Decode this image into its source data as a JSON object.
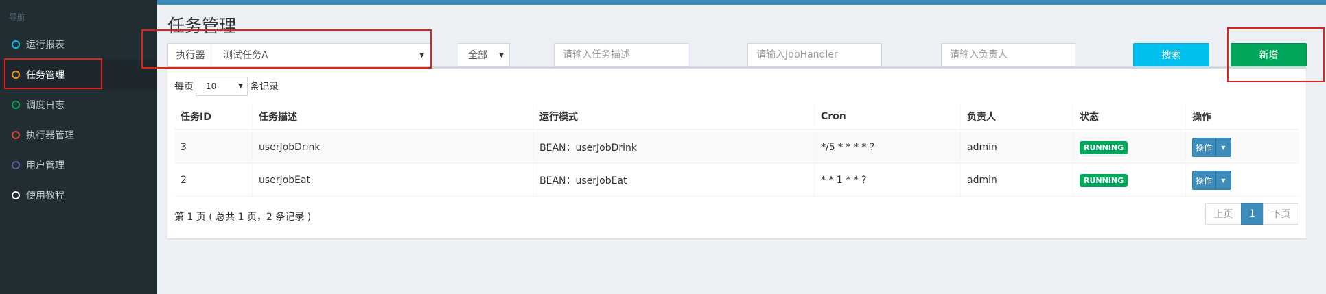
{
  "sidebar": {
    "header": "导航",
    "items": [
      {
        "label": "运行报表",
        "color": "#00c0ef",
        "icon": "circle-outline-icon"
      },
      {
        "label": "任务管理",
        "color": "#f39c12",
        "icon": "circle-outline-icon",
        "active": true
      },
      {
        "label": "调度日志",
        "color": "#00a65a",
        "icon": "circle-outline-icon"
      },
      {
        "label": "执行器管理",
        "color": "#dd4b39",
        "icon": "circle-outline-icon"
      },
      {
        "label": "用户管理",
        "color": "#605ca8",
        "icon": "circle-outline-icon"
      },
      {
        "label": "使用教程",
        "color": "#ffffff",
        "icon": "circle-outline-icon"
      }
    ]
  },
  "main": {
    "title": "任务管理"
  },
  "filters": {
    "executor_label": "执行器",
    "executor_value": "测试任务A",
    "status_value": "全部",
    "desc_placeholder": "请输入任务描述",
    "handler_placeholder": "请输入JobHandler",
    "author_placeholder": "请输入负责人",
    "search_label": "搜索",
    "add_label": "新增"
  },
  "table": {
    "per_page_prefix": "每页",
    "per_page_value": "10",
    "per_page_suffix": "条记录",
    "columns": [
      "任务ID",
      "任务描述",
      "运行模式",
      "Cron",
      "负责人",
      "状态",
      "操作"
    ],
    "rows": [
      {
        "id": "3",
        "desc": "userJobDrink",
        "mode": "BEAN：userJobDrink",
        "cron": "*/5 * * * * ?",
        "author": "admin",
        "status": "RUNNING",
        "op": "操作"
      },
      {
        "id": "2",
        "desc": "userJobEat",
        "mode": "BEAN：userJobEat",
        "cron": "* * 1 * * ?",
        "author": "admin",
        "status": "RUNNING",
        "op": "操作"
      }
    ],
    "info": "第 1 页 ( 总共 1 页，2 条记录 )",
    "pager": {
      "prev": "上页",
      "current": "1",
      "next": "下页"
    }
  },
  "colors": {
    "sidebar_bg": "#222d32",
    "accent": "#3c8dbc",
    "success": "#00a65a",
    "info": "#00c0ef",
    "highlight": "#e0231a"
  }
}
